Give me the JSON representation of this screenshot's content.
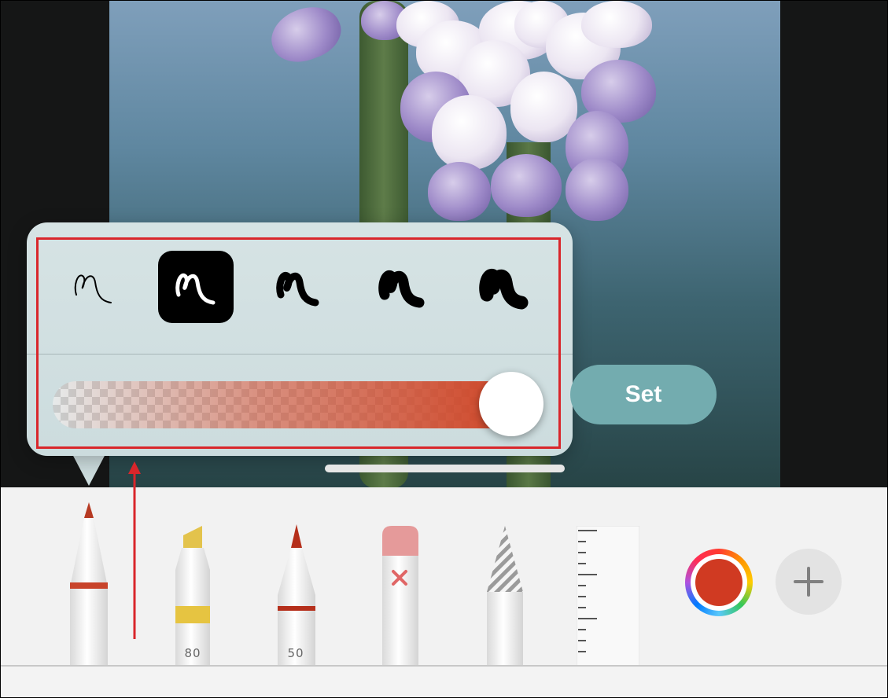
{
  "stroke_widths": {
    "options": [
      "thinnest",
      "thin",
      "medium",
      "thick",
      "thickest"
    ],
    "selected_index": 1
  },
  "opacity_slider": {
    "value": 1.0,
    "color": "#cf4526"
  },
  "set_button": {
    "label": "Set"
  },
  "tools": {
    "pen": {
      "name": "pen",
      "band_color": "#c8432a"
    },
    "marker": {
      "name": "marker",
      "number": "80",
      "color": "#e6c441"
    },
    "pencil": {
      "name": "pencil",
      "number": "50",
      "color": "#b52f1b"
    },
    "eraser": {
      "name": "eraser"
    },
    "lasso": {
      "name": "lasso"
    },
    "ruler": {
      "name": "ruler"
    }
  },
  "color_picker": {
    "current_color": "#d03a22"
  },
  "add_button": {
    "icon": "plus-icon"
  },
  "annotation": {
    "highlight_color": "#d9262b"
  }
}
